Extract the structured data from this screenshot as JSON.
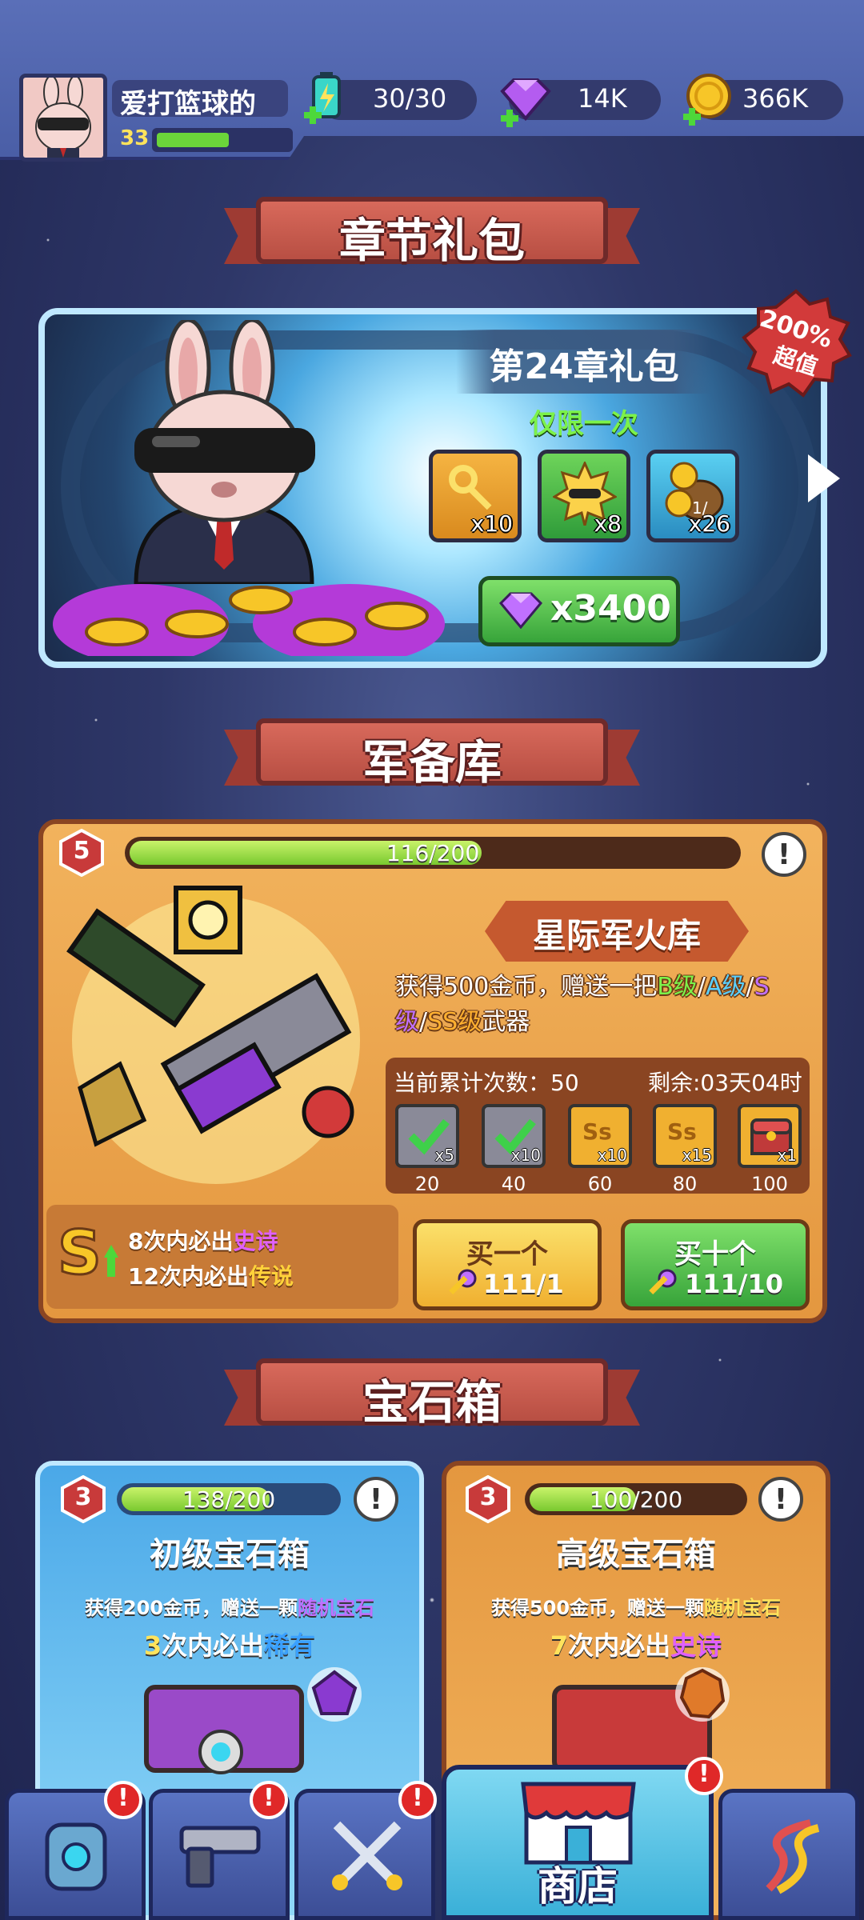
{
  "player": {
    "name": "爱打篮球的",
    "level": "33",
    "xp_fraction": 0.55
  },
  "resources": {
    "energy": "30/30",
    "gems": "14K",
    "coins": "366K"
  },
  "sections": {
    "chapter": "章节礼包",
    "armory": "军备库",
    "gem_chest": "宝石箱"
  },
  "chapter_pack": {
    "title": "第24章礼包",
    "limit": "仅限一次",
    "badge_line1": "200%",
    "badge_line2": "超值",
    "items": [
      {
        "icon": "golden-key-icon",
        "count": "x10"
      },
      {
        "icon": "sunglasses-badge-icon",
        "count": "x8"
      },
      {
        "icon": "coin-bag-icon",
        "count": "x26",
        "fraction": "1/"
      }
    ],
    "gem_reward": "x3400"
  },
  "armory": {
    "level": "5",
    "progress_text": "116/200",
    "progress_fraction": 0.58,
    "title": "星际军火库",
    "desc_prefix": "获得500金币，赠送一把",
    "desc_b": "B级",
    "desc_sep1": "/",
    "desc_a": "A级",
    "desc_sep2": "/",
    "desc_s": "S",
    "desc_newline_s": "级",
    "desc_sep3": "/",
    "desc_ss": "SS级",
    "desc_suffix": "武器",
    "count_label": "当前累计次数：50",
    "remaining_label": "剩余:03天04时",
    "milestones": [
      {
        "mult": "x5",
        "value": "20",
        "icon": "check-icon"
      },
      {
        "mult": "x10",
        "value": "40",
        "icon": "check-icon"
      },
      {
        "mult": "x10",
        "value": "60",
        "icon": "ss-ticket-icon"
      },
      {
        "mult": "x15",
        "value": "80",
        "icon": "ss-ticket-icon"
      },
      {
        "mult": "x1",
        "value": "100",
        "icon": "chest-icon"
      }
    ],
    "guarantee_1_prefix": "8次内必出",
    "guarantee_1_rarity": "史诗",
    "guarantee_2_prefix": "12次内必出",
    "guarantee_2_rarity": "传说",
    "buy_one_label": "买一个",
    "buy_one_price": "111/1",
    "buy_ten_label": "买十个",
    "buy_ten_price": "111/10"
  },
  "gem_chests": [
    {
      "level": "3",
      "progress_text": "138/200",
      "progress_fraction": 0.69,
      "title": "初级宝石箱",
      "desc_prefix": "获得200金币，赠送一颗",
      "desc_highlight": "随机宝石",
      "guar_num": "3",
      "guar_mid": "次内必出",
      "guar_rarity": "稀有"
    },
    {
      "level": "3",
      "progress_text": "100/200",
      "progress_fraction": 0.5,
      "title": "高级宝石箱",
      "desc_prefix": "获得500金币，赠送一颗",
      "desc_highlight": "随机宝石",
      "guar_num": "7",
      "guar_mid": "次内必出",
      "guar_rarity": "史诗"
    }
  ],
  "nav": {
    "tabs": [
      {
        "icon": "armor-icon",
        "alert": "!"
      },
      {
        "icon": "pistol-icon",
        "alert": "!"
      },
      {
        "icon": "crossed-swords-icon",
        "alert": "!"
      },
      {
        "icon": "shop-icon",
        "label": "商店",
        "alert": "!"
      },
      {
        "icon": "dna-icon"
      }
    ]
  },
  "colors": {
    "green_rarity": "#7cf24a",
    "blue_rarity": "#5ad0ff",
    "purple_rarity": "#c070ff",
    "epic": "#e060ff",
    "legend": "#ffd23a",
    "rare": "#3aa0ff",
    "accent_orange": "#e4973f"
  }
}
